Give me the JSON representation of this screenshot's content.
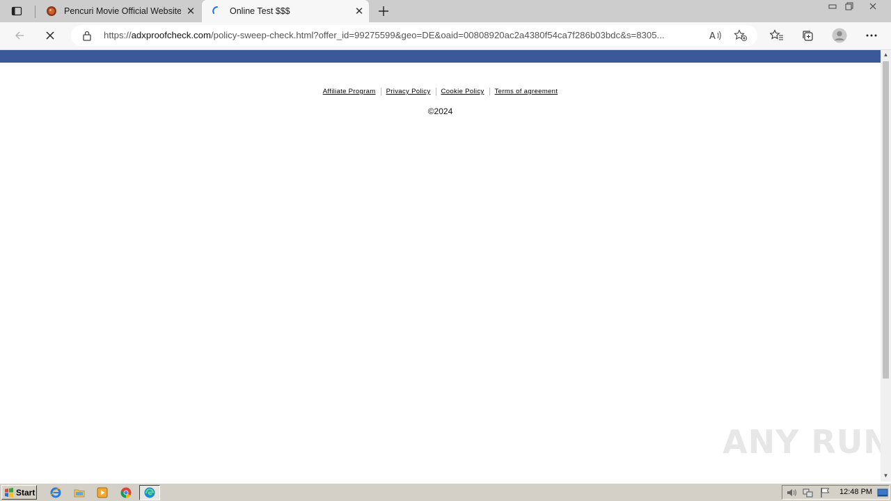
{
  "browser": {
    "tabs": [
      {
        "title": "Pencuri Movie Official Website",
        "favicon": "pencuri-favicon",
        "active": false
      },
      {
        "title": "Online Test $$$",
        "favicon": "loading-spinner",
        "active": true
      }
    ],
    "new_tab_icon": "plus-icon",
    "url_prefix": "https://",
    "url_host": "adxproofcheck.com",
    "url_path": "/policy-sweep-check.html?offer_id=99275599&geo=DE&oaid=00808920ac2a4380f54ca7f286b03bdc&s=8305...",
    "toolbar_icons": [
      "read-aloud-icon",
      "add-favorite-icon",
      "favorites-icon",
      "collections-icon",
      "profile-icon",
      "more-icon"
    ]
  },
  "page": {
    "brand_color": "#3b5998",
    "footer_links": [
      "Affiliate Program",
      "Privacy Policy",
      "Cookie Policy",
      "Terms of agreement"
    ],
    "copyright": "©2024"
  },
  "watermark": "ANY RUN",
  "taskbar": {
    "start_label": "Start",
    "apps": [
      "internet-explorer-icon",
      "file-explorer-icon",
      "media-player-icon",
      "chrome-icon",
      "edge-icon"
    ],
    "clock": "12:48 PM"
  }
}
